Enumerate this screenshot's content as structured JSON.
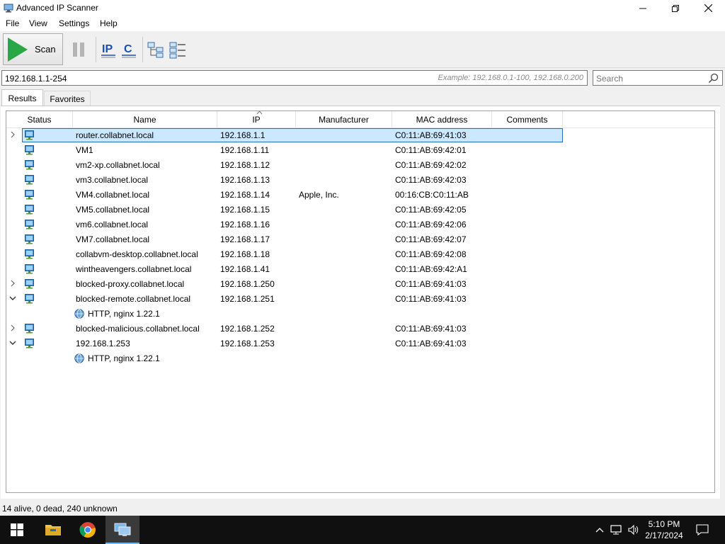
{
  "window": {
    "title": "Advanced IP Scanner"
  },
  "menu": {
    "items": [
      "File",
      "View",
      "Settings",
      "Help"
    ]
  },
  "toolbar": {
    "scan_label": "Scan"
  },
  "address": {
    "value": "192.168.1.1-254",
    "example": "Example: 192.168.0.1-100, 192.168.0.200"
  },
  "search": {
    "placeholder": "Search"
  },
  "tabs": {
    "results": "Results",
    "favorites": "Favorites"
  },
  "table": {
    "columns": [
      "Status",
      "Name",
      "IP",
      "Manufacturer",
      "MAC address",
      "Comments"
    ],
    "rows": [
      {
        "expander": "collapsed",
        "name": "router.collabnet.local",
        "ip": "192.168.1.1",
        "manufacturer": "",
        "mac": "C0:11:AB:69:41:03",
        "selected": true
      },
      {
        "expander": "",
        "name": "VM1",
        "ip": "192.168.1.11",
        "manufacturer": "",
        "mac": "C0:11:AB:69:42:01"
      },
      {
        "expander": "",
        "name": "vm2-xp.collabnet.local",
        "ip": "192.168.1.12",
        "manufacturer": "",
        "mac": "C0:11:AB:69:42:02"
      },
      {
        "expander": "",
        "name": "vm3.collabnet.local",
        "ip": "192.168.1.13",
        "manufacturer": "",
        "mac": "C0:11:AB:69:42:03"
      },
      {
        "expander": "",
        "name": "VM4.collabnet.local",
        "ip": "192.168.1.14",
        "manufacturer": "Apple, Inc.",
        "mac": "00:16:CB:C0:11:AB"
      },
      {
        "expander": "",
        "name": "VM5.collabnet.local",
        "ip": "192.168.1.15",
        "manufacturer": "",
        "mac": "C0:11:AB:69:42:05"
      },
      {
        "expander": "",
        "name": "vm6.collabnet.local",
        "ip": "192.168.1.16",
        "manufacturer": "",
        "mac": "C0:11:AB:69:42:06"
      },
      {
        "expander": "",
        "name": "VM7.collabnet.local",
        "ip": "192.168.1.17",
        "manufacturer": "",
        "mac": "C0:11:AB:69:42:07"
      },
      {
        "expander": "",
        "name": "collabvm-desktop.collabnet.local",
        "ip": "192.168.1.18",
        "manufacturer": "",
        "mac": "C0:11:AB:69:42:08"
      },
      {
        "expander": "",
        "name": "wintheavengers.collabnet.local",
        "ip": "192.168.1.41",
        "manufacturer": "",
        "mac": "C0:11:AB:69:42:A1"
      },
      {
        "expander": "collapsed",
        "name": "blocked-proxy.collabnet.local",
        "ip": "192.168.1.250",
        "manufacturer": "",
        "mac": "C0:11:AB:69:41:03"
      },
      {
        "expander": "expanded",
        "name": "blocked-remote.collabnet.local",
        "ip": "192.168.1.251",
        "manufacturer": "",
        "mac": "C0:11:AB:69:41:03"
      },
      {
        "service": "HTTP, nginx 1.22.1"
      },
      {
        "expander": "collapsed",
        "name": "blocked-malicious.collabnet.local",
        "ip": "192.168.1.252",
        "manufacturer": "",
        "mac": "C0:11:AB:69:41:03"
      },
      {
        "expander": "expanded",
        "name": "192.168.1.253",
        "ip": "192.168.1.253",
        "manufacturer": "",
        "mac": "C0:11:AB:69:41:03"
      },
      {
        "service": "HTTP, nginx 1.22.1"
      }
    ]
  },
  "status": {
    "text": "14 alive, 0 dead, 240 unknown"
  },
  "taskbar": {
    "time": "5:10 PM",
    "date": "2/17/2024"
  },
  "colors": {
    "accent": "#1f6fbd",
    "selection": "#cce8ff",
    "scan_green": "#29a745"
  }
}
